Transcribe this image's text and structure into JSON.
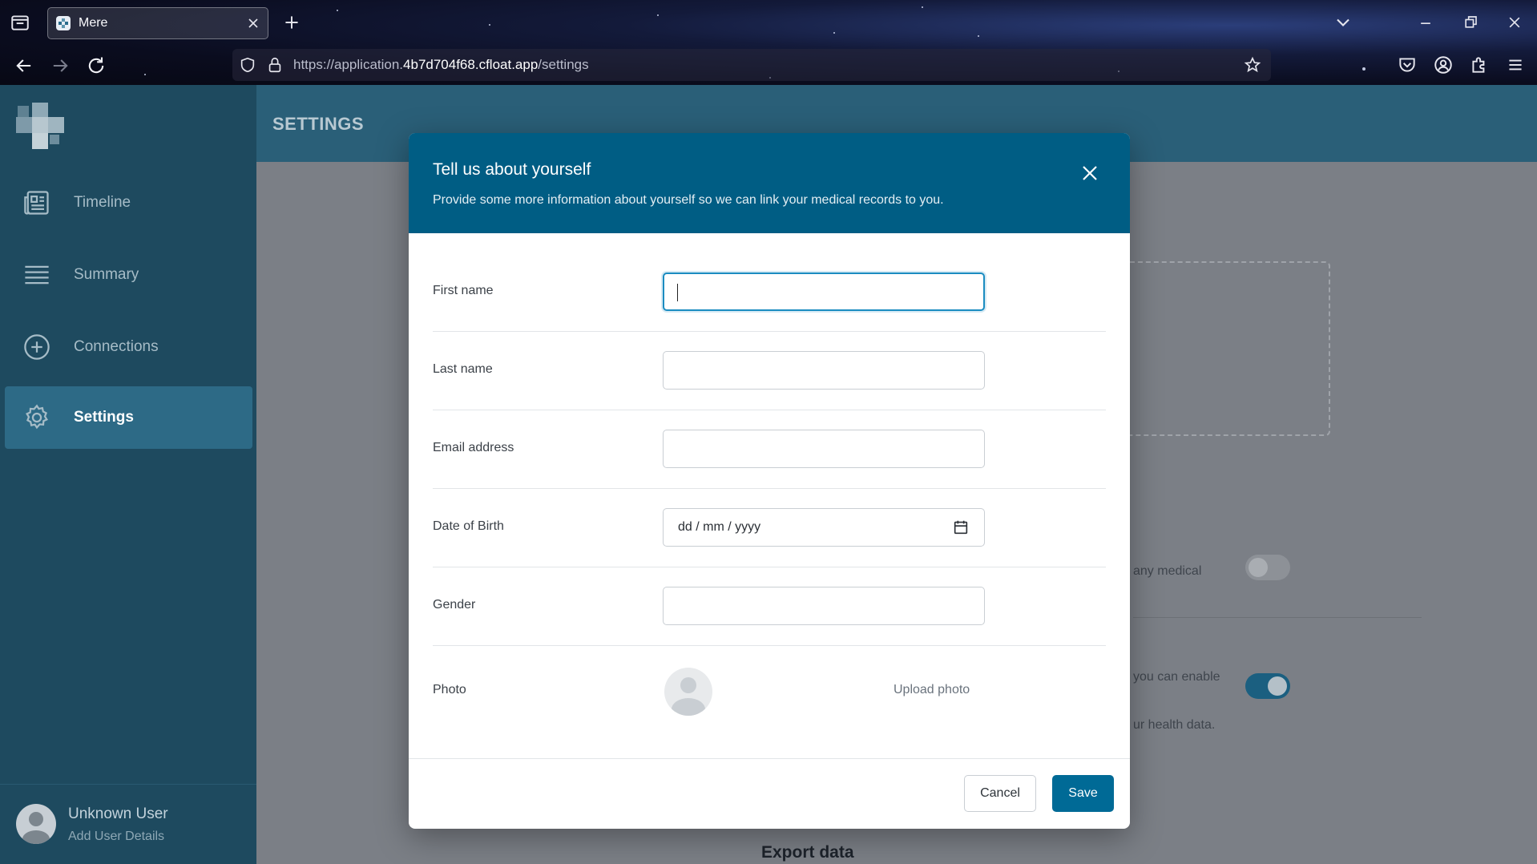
{
  "browser": {
    "tab_title": "Mere",
    "url_prefix": "https://application.",
    "url_host": "4b7d704f68.cfloat.app",
    "url_path": "/settings"
  },
  "sidebar": {
    "items": [
      {
        "label": "Timeline",
        "icon": "newspaper-icon"
      },
      {
        "label": "Summary",
        "icon": "list-lines-icon"
      },
      {
        "label": "Connections",
        "icon": "plus-circle-icon"
      },
      {
        "label": "Settings",
        "icon": "gear-icon",
        "active": true
      }
    ],
    "user": {
      "name": "Unknown User",
      "subtitle": "Add User Details"
    }
  },
  "main": {
    "title": "SETTINGS",
    "background_texts": {
      "medical": "any medical",
      "enable": "you can enable",
      "health": "ur health data.",
      "export": "Export data"
    },
    "toggles": [
      {
        "on": false
      },
      {
        "on": true
      }
    ]
  },
  "modal": {
    "title": "Tell us about yourself",
    "description": "Provide some more information about yourself so we can link your medical records to you.",
    "fields": {
      "first_name": {
        "label": "First name",
        "value": ""
      },
      "last_name": {
        "label": "Last name",
        "value": ""
      },
      "email": {
        "label": "Email address",
        "value": ""
      },
      "dob": {
        "label": "Date of Birth",
        "placeholder": "dd / mm / yyyy"
      },
      "gender": {
        "label": "Gender",
        "value": ""
      },
      "photo": {
        "label": "Photo",
        "upload_label": "Upload photo"
      }
    },
    "cancel_label": "Cancel",
    "save_label": "Save"
  },
  "colors": {
    "accent": "#005d84",
    "save_button": "#006a96",
    "focus_ring": "#1b8cc1",
    "sidebar": "#1e4a5f",
    "toggle_on": "#1b6d96"
  }
}
